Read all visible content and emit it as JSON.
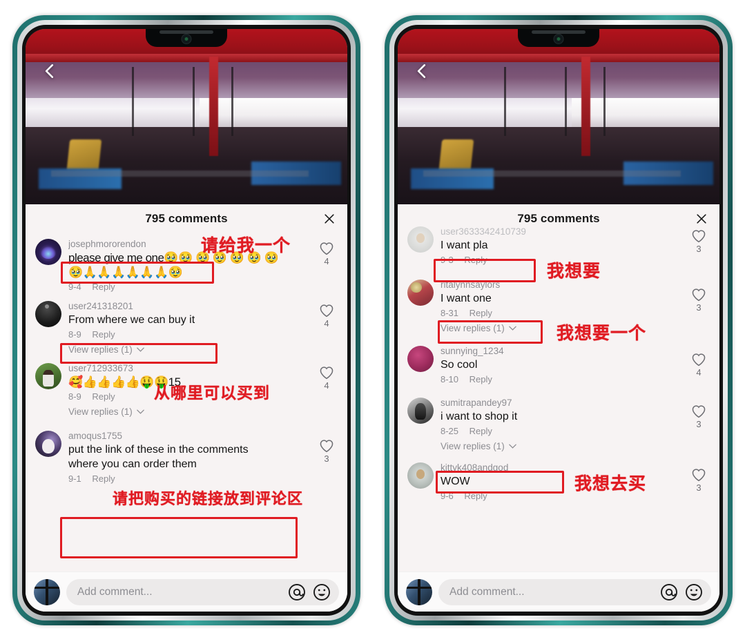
{
  "app": {
    "sheet_title": "795 comments",
    "composer_placeholder": "Add comment...",
    "reply_label": "Reply",
    "view_replies_label": "View replies (1)",
    "close_icon": "close-icon",
    "back_icon": "back-chevron-icon",
    "mention_icon": "at-mention-icon",
    "emoji_icon": "emoji-smiley-icon",
    "heart_icon": "heart-outline-icon"
  },
  "colors": {
    "annotation_red": "#e01b22",
    "phone_frame_teal": "#2b8a85",
    "sheet_bg": "#f7f3f3",
    "text_primary": "#131313",
    "text_muted": "#8d8d92"
  },
  "left_phone": {
    "comments": [
      {
        "user": "josephmororendon",
        "text": "please give me one🥹🥹 🥹 🥹 🥹 🥹 🥹",
        "text2": "🥹🙏🙏🙏🙏🙏🙏🥹",
        "date": "9-4",
        "likes": "4",
        "has_replies": false
      },
      {
        "user": "user241318201",
        "text": "From where we can buy it",
        "text2": "",
        "date": "8-9",
        "likes": "4",
        "has_replies": true
      },
      {
        "user": "user712933673",
        "text": "🥰👍👍👍👍🤑🤑15",
        "text2": "",
        "date": "8-9",
        "likes": "4",
        "has_replies": true
      },
      {
        "user": "amoqus1755",
        "text": "put the link of these in the comments",
        "text2": "where you can order them",
        "date": "9-1",
        "likes": "3",
        "has_replies": false
      }
    ],
    "annotations": [
      {
        "cn": "请给我一个"
      },
      {
        "cn": "从哪里可以买到"
      },
      {
        "cn": "请把购买的链接放到评论区"
      }
    ]
  },
  "right_phone": {
    "comments": [
      {
        "user": "user3633342410739",
        "text": "I want pla",
        "text2": "",
        "date": "9-3",
        "likes": "3",
        "has_replies": false,
        "cut_off": true
      },
      {
        "user": "ritalynnsaylors",
        "text": "I want one",
        "text2": "",
        "date": "8-31",
        "likes": "3",
        "has_replies": true
      },
      {
        "user": "sunnying_1234",
        "text": "So cool",
        "text2": "",
        "date": "8-10",
        "likes": "4",
        "has_replies": false
      },
      {
        "user": "sumitrapandey97",
        "text": "i want to shop it",
        "text2": "",
        "date": "8-25",
        "likes": "3",
        "has_replies": true
      },
      {
        "user": "kittyk408andgod",
        "text": "WOW",
        "text2": "",
        "date": "9-6",
        "likes": "3",
        "has_replies": false
      }
    ],
    "annotations": [
      {
        "cn": "我想要"
      },
      {
        "cn": "我想要一个"
      },
      {
        "cn": "我想去买"
      }
    ]
  }
}
